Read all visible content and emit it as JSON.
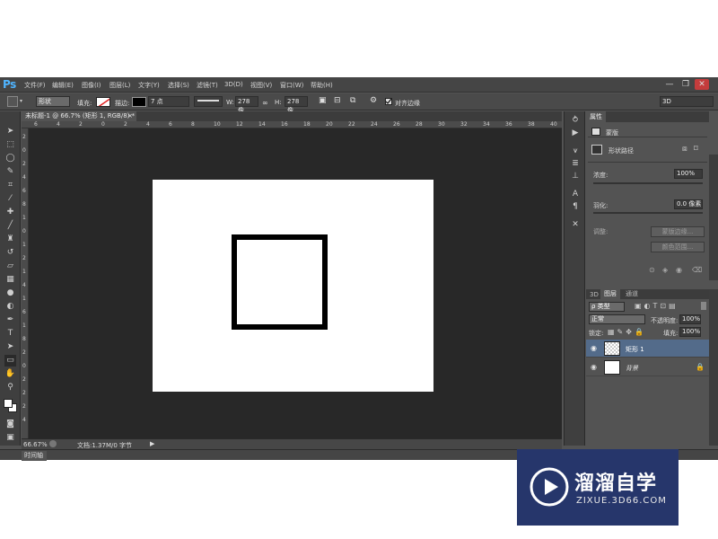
{
  "app": {
    "logo": "Ps"
  },
  "menu": [
    "文件(F)",
    "编辑(E)",
    "图像(I)",
    "图层(L)",
    "文字(Y)",
    "选择(S)",
    "滤镜(T)",
    "3D(D)",
    "视图(V)",
    "窗口(W)",
    "帮助(H)"
  ],
  "window_controls": [
    "—",
    "❐",
    "✕"
  ],
  "options": {
    "mode": "形状",
    "fill_label": "填充:",
    "stroke_label": "描边:",
    "stroke_size": "7 点",
    "w_label": "W:",
    "w_value": "278 像",
    "h_label": "H:",
    "h_value": "278 像",
    "align_edges": "对齐边缘",
    "workspace": "3D"
  },
  "document": {
    "tab_title": "未标题-1 @ 66.7% (矩形 1, RGB/8) *",
    "close": "×"
  },
  "ruler_top": [
    "6",
    "4",
    "2",
    "0",
    "2",
    "4",
    "6",
    "8",
    "10",
    "12",
    "14",
    "16",
    "18",
    "20",
    "22",
    "24",
    "26",
    "28",
    "30",
    "32",
    "34",
    "36",
    "38",
    "40"
  ],
  "ruler_left": [
    "2",
    "0",
    "2",
    "4",
    "6",
    "8",
    "1",
    "0",
    "1",
    "2",
    "1",
    "4",
    "1",
    "6",
    "1",
    "8",
    "2",
    "0",
    "2",
    "2",
    "2",
    "4"
  ],
  "status": {
    "zoom": "66.67%",
    "doc_info": "文档:1.37M/0 字节"
  },
  "timeline": {
    "label": "时间轴"
  },
  "properties": {
    "tab": "属性",
    "mask_label": "蒙版",
    "shape_path_label": "形状路径",
    "density_label": "浓度:",
    "density_value": "100%",
    "feather_label": "羽化:",
    "feather_value": "0.0 像素",
    "adjust_label": "调整:",
    "mask_edge_btn": "蒙版边缘...",
    "color_range_btn": "颜色范围..."
  },
  "layers_panel": {
    "tabs": [
      "3D",
      "图层",
      "通道"
    ],
    "filter_kind": "ρ 类型",
    "blend_mode": "正常",
    "opacity_label": "不透明度:",
    "opacity_value": "100%",
    "lock_label": "锁定:",
    "fill_label": "填充:",
    "fill_value": "100%",
    "layers": [
      {
        "name": "矩形 1",
        "selected": true
      },
      {
        "name": "背景",
        "selected": false
      }
    ]
  },
  "watermark": {
    "title": "溜溜自学",
    "url": "ZIXUE.3D66.COM"
  },
  "colors": {
    "accent": "#4fb4ff",
    "canvas_bg": "#282828",
    "panel": "#535353",
    "selected_layer": "#536b8a",
    "watermark_bg": "#26366b"
  }
}
